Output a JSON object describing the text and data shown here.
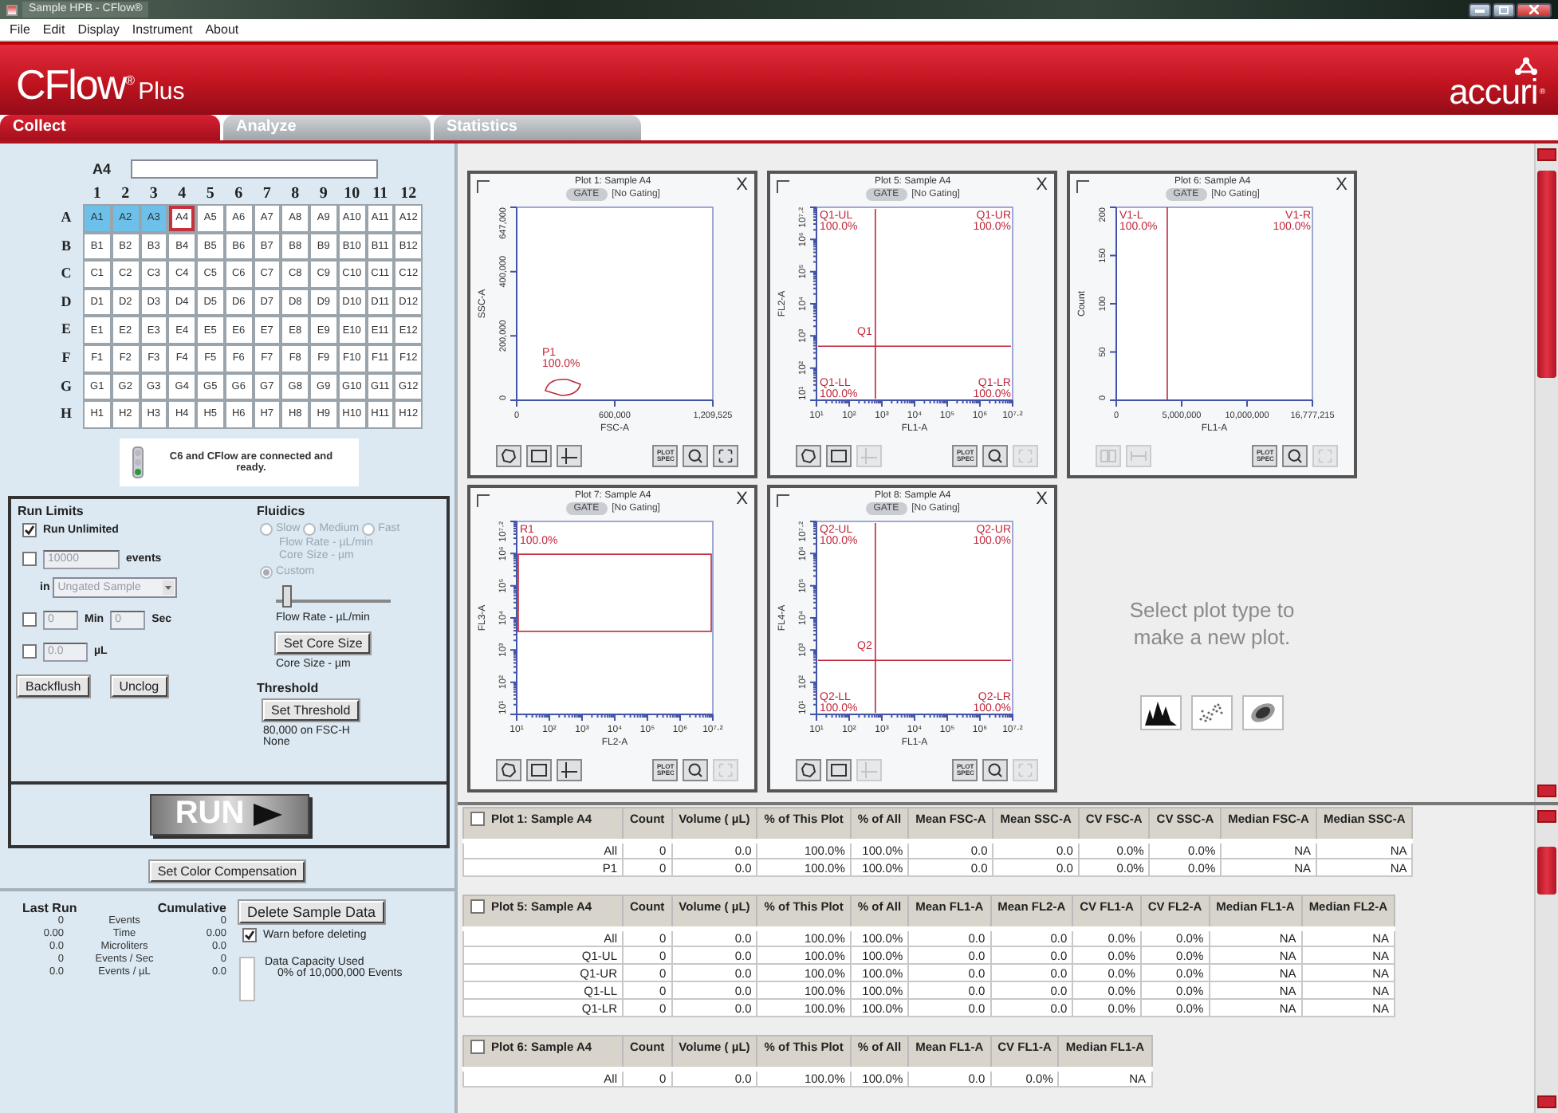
{
  "window": {
    "title": "Sample HPB - CFlow®"
  },
  "menu": [
    "File",
    "Edit",
    "Display",
    "Instrument",
    "About"
  ],
  "header": {
    "product": "CFlow",
    "product_mark": "®",
    "edition": "Plus",
    "brand": "accuri",
    "brand_mark": "®"
  },
  "tabs": [
    {
      "label": "Collect",
      "selected": true
    },
    {
      "label": "Analyze",
      "selected": false
    },
    {
      "label": "Statistics",
      "selected": false
    }
  ],
  "plate": {
    "current": "A4",
    "columns": [
      "1",
      "2",
      "3",
      "4",
      "5",
      "6",
      "7",
      "8",
      "9",
      "10",
      "11",
      "12"
    ],
    "rows": [
      {
        "label": "A",
        "wells": [
          {
            "label": "A1",
            "selected": true,
            "current": false
          },
          {
            "label": "A2",
            "selected": true,
            "current": false
          },
          {
            "label": "A3",
            "selected": true,
            "current": false
          },
          {
            "label": "A4",
            "selected": false,
            "current": true
          },
          {
            "label": "A5",
            "selected": false,
            "current": false
          },
          {
            "label": "A6",
            "selected": false,
            "current": false
          },
          {
            "label": "A7",
            "selected": false,
            "current": false
          },
          {
            "label": "A8",
            "selected": false,
            "current": false
          },
          {
            "label": "A9",
            "selected": false,
            "current": false
          },
          {
            "label": "A10",
            "selected": false,
            "current": false
          },
          {
            "label": "A11",
            "selected": false,
            "current": false
          },
          {
            "label": "A12",
            "selected": false,
            "current": false
          }
        ]
      },
      {
        "label": "B",
        "wells": [
          {
            "label": "B1",
            "selected": false,
            "current": false
          },
          {
            "label": "B2",
            "selected": false,
            "current": false
          },
          {
            "label": "B3",
            "selected": false,
            "current": false
          },
          {
            "label": "B4",
            "selected": false,
            "current": false
          },
          {
            "label": "B5",
            "selected": false,
            "current": false
          },
          {
            "label": "B6",
            "selected": false,
            "current": false
          },
          {
            "label": "B7",
            "selected": false,
            "current": false
          },
          {
            "label": "B8",
            "selected": false,
            "current": false
          },
          {
            "label": "B9",
            "selected": false,
            "current": false
          },
          {
            "label": "B10",
            "selected": false,
            "current": false
          },
          {
            "label": "B11",
            "selected": false,
            "current": false
          },
          {
            "label": "B12",
            "selected": false,
            "current": false
          }
        ]
      },
      {
        "label": "C",
        "wells": [
          {
            "label": "C1",
            "selected": false,
            "current": false
          },
          {
            "label": "C2",
            "selected": false,
            "current": false
          },
          {
            "label": "C3",
            "selected": false,
            "current": false
          },
          {
            "label": "C4",
            "selected": false,
            "current": false
          },
          {
            "label": "C5",
            "selected": false,
            "current": false
          },
          {
            "label": "C6",
            "selected": false,
            "current": false
          },
          {
            "label": "C7",
            "selected": false,
            "current": false
          },
          {
            "label": "C8",
            "selected": false,
            "current": false
          },
          {
            "label": "C9",
            "selected": false,
            "current": false
          },
          {
            "label": "C10",
            "selected": false,
            "current": false
          },
          {
            "label": "C11",
            "selected": false,
            "current": false
          },
          {
            "label": "C12",
            "selected": false,
            "current": false
          }
        ]
      },
      {
        "label": "D",
        "wells": [
          {
            "label": "D1",
            "selected": false,
            "current": false
          },
          {
            "label": "D2",
            "selected": false,
            "current": false
          },
          {
            "label": "D3",
            "selected": false,
            "current": false
          },
          {
            "label": "D4",
            "selected": false,
            "current": false
          },
          {
            "label": "D5",
            "selected": false,
            "current": false
          },
          {
            "label": "D6",
            "selected": false,
            "current": false
          },
          {
            "label": "D7",
            "selected": false,
            "current": false
          },
          {
            "label": "D8",
            "selected": false,
            "current": false
          },
          {
            "label": "D9",
            "selected": false,
            "current": false
          },
          {
            "label": "D10",
            "selected": false,
            "current": false
          },
          {
            "label": "D11",
            "selected": false,
            "current": false
          },
          {
            "label": "D12",
            "selected": false,
            "current": false
          }
        ]
      },
      {
        "label": "E",
        "wells": [
          {
            "label": "E1",
            "selected": false,
            "current": false
          },
          {
            "label": "E2",
            "selected": false,
            "current": false
          },
          {
            "label": "E3",
            "selected": false,
            "current": false
          },
          {
            "label": "E4",
            "selected": false,
            "current": false
          },
          {
            "label": "E5",
            "selected": false,
            "current": false
          },
          {
            "label": "E6",
            "selected": false,
            "current": false
          },
          {
            "label": "E7",
            "selected": false,
            "current": false
          },
          {
            "label": "E8",
            "selected": false,
            "current": false
          },
          {
            "label": "E9",
            "selected": false,
            "current": false
          },
          {
            "label": "E10",
            "selected": false,
            "current": false
          },
          {
            "label": "E11",
            "selected": false,
            "current": false
          },
          {
            "label": "E12",
            "selected": false,
            "current": false
          }
        ]
      },
      {
        "label": "F",
        "wells": [
          {
            "label": "F1",
            "selected": false,
            "current": false
          },
          {
            "label": "F2",
            "selected": false,
            "current": false
          },
          {
            "label": "F3",
            "selected": false,
            "current": false
          },
          {
            "label": "F4",
            "selected": false,
            "current": false
          },
          {
            "label": "F5",
            "selected": false,
            "current": false
          },
          {
            "label": "F6",
            "selected": false,
            "current": false
          },
          {
            "label": "F7",
            "selected": false,
            "current": false
          },
          {
            "label": "F8",
            "selected": false,
            "current": false
          },
          {
            "label": "F9",
            "selected": false,
            "current": false
          },
          {
            "label": "F10",
            "selected": false,
            "current": false
          },
          {
            "label": "F11",
            "selected": false,
            "current": false
          },
          {
            "label": "F12",
            "selected": false,
            "current": false
          }
        ]
      },
      {
        "label": "G",
        "wells": [
          {
            "label": "G1",
            "selected": false,
            "current": false
          },
          {
            "label": "G2",
            "selected": false,
            "current": false
          },
          {
            "label": "G3",
            "selected": false,
            "current": false
          },
          {
            "label": "G4",
            "selected": false,
            "current": false
          },
          {
            "label": "G5",
            "selected": false,
            "current": false
          },
          {
            "label": "G6",
            "selected": false,
            "current": false
          },
          {
            "label": "G7",
            "selected": false,
            "current": false
          },
          {
            "label": "G8",
            "selected": false,
            "current": false
          },
          {
            "label": "G9",
            "selected": false,
            "current": false
          },
          {
            "label": "G10",
            "selected": false,
            "current": false
          },
          {
            "label": "G11",
            "selected": false,
            "current": false
          },
          {
            "label": "G12",
            "selected": false,
            "current": false
          }
        ]
      },
      {
        "label": "H",
        "wells": [
          {
            "label": "H1",
            "selected": false,
            "current": false
          },
          {
            "label": "H2",
            "selected": false,
            "current": false
          },
          {
            "label": "H3",
            "selected": false,
            "current": false
          },
          {
            "label": "H4",
            "selected": false,
            "current": false
          },
          {
            "label": "H5",
            "selected": false,
            "current": false
          },
          {
            "label": "H6",
            "selected": false,
            "current": false
          },
          {
            "label": "H7",
            "selected": false,
            "current": false
          },
          {
            "label": "H8",
            "selected": false,
            "current": false
          },
          {
            "label": "H9",
            "selected": false,
            "current": false
          },
          {
            "label": "H10",
            "selected": false,
            "current": false
          },
          {
            "label": "H11",
            "selected": false,
            "current": false
          },
          {
            "label": "H12",
            "selected": false,
            "current": false
          }
        ]
      }
    ]
  },
  "status": "C6 and CFlow are connected and ready.",
  "run_limits": {
    "title": "Run Limits",
    "unlimited": {
      "label": "Run Unlimited",
      "checked": true
    },
    "events": {
      "checked": false,
      "value": "10000",
      "unit": "events"
    },
    "gate": {
      "prefix": "in",
      "value": "Ungated Sample"
    },
    "time": {
      "checked": false,
      "min": "0",
      "min_unit": "Min",
      "sec": "0",
      "sec_unit": "Sec"
    },
    "volume": {
      "checked": false,
      "value": "0.0",
      "unit": "µL"
    },
    "buttons": [
      "Backflush",
      "Unclog"
    ]
  },
  "fluidics": {
    "title": "Fluidics",
    "disabled": true,
    "speeds": [
      {
        "label": "Slow",
        "selected": false
      },
      {
        "label": "Medium",
        "selected": false
      },
      {
        "label": "Fast",
        "selected": false
      }
    ],
    "speed_info": [
      "Flow Rate - µL/min",
      "Core Size - µm"
    ],
    "custom": {
      "label": "Custom",
      "selected": true
    },
    "flow": {
      "level": 0.1,
      "label": "Flow Rate  - µL/min"
    },
    "core_button": "Set Core Size",
    "core_label": "Core Size - µm"
  },
  "threshold": {
    "title": "Threshold",
    "button": "Set Threshold",
    "lines": [
      "80,000 on FSC-H",
      "None"
    ]
  },
  "run_button": "RUN",
  "compensation_button": "Set Color Compensation",
  "counters": {
    "headers": [
      "Last Run",
      "Cumulative"
    ],
    "rows": [
      {
        "last": "0",
        "label": "Events",
        "total": "0"
      },
      {
        "last": "0.00",
        "label": "Time",
        "total": "0.00"
      },
      {
        "last": "0.0",
        "label": "Microliters",
        "total": "0.0"
      },
      {
        "last": "0",
        "label": "Events / Sec",
        "total": "0"
      },
      {
        "last": "0.0",
        "label": "Events / µL",
        "total": "0.0"
      }
    ]
  },
  "delete": {
    "button": "Delete Sample Data",
    "warn": {
      "label": "Warn before deleting",
      "checked": true
    },
    "capacity": {
      "title": "Data Capacity Used",
      "level": 0,
      "note": "0% of 10,000,000 Events"
    }
  },
  "plots": [
    {
      "title": "Plot 1: Sample A4",
      "checked": false,
      "gate_button": "GATE",
      "gating": "[No Gating]",
      "close": "X",
      "kind": "linear",
      "x_label": "FSC-A",
      "y_label": "SSC-A",
      "x_ticks": [
        "0",
        "600,000",
        "1,209,525"
      ],
      "y_ticks": [
        "0",
        "200,000",
        "400,000",
        "647,000"
      ],
      "gate": {
        "kind": "polygon",
        "regions": [
          {
            "name": "P1",
            "percent": "100.0%"
          }
        ]
      },
      "tools": [
        {
          "kind": "polygon",
          "disabled": false
        },
        {
          "kind": "rectangle",
          "disabled": false
        },
        {
          "kind": "quadrant",
          "disabled": false
        },
        {
          "kind": "spec",
          "label": "PLOT SPEC",
          "disabled": false
        },
        {
          "kind": "zoom",
          "disabled": false
        },
        {
          "kind": "fit",
          "disabled": false
        }
      ]
    },
    {
      "title": "Plot 5: Sample A4",
      "checked": false,
      "gate_button": "GATE",
      "gating": "[No Gating]",
      "close": "X",
      "kind": "log",
      "x_label": "FL1-A",
      "y_label": "FL2-A",
      "x_ticks": [
        "10¹",
        "10²",
        "10³",
        "10⁴",
        "10⁵",
        "10⁶",
        "10⁷·²"
      ],
      "y_ticks": [
        "10¹",
        "10²",
        "10³",
        "10⁴",
        "10⁵",
        "10⁶",
        "10⁷·²"
      ],
      "gate": {
        "kind": "quadrant",
        "label": "Q1",
        "regions": [
          {
            "name": "Q1-UL",
            "percent": "100.0%"
          },
          {
            "name": "Q1-UR",
            "percent": "100.0%"
          },
          {
            "name": "Q1-LL",
            "percent": "100.0%"
          },
          {
            "name": "Q1-LR",
            "percent": "100.0%"
          }
        ]
      },
      "tools": [
        {
          "kind": "polygon",
          "disabled": false
        },
        {
          "kind": "rectangle",
          "disabled": false
        },
        {
          "kind": "quadrant",
          "disabled": true
        },
        {
          "kind": "spec",
          "label": "PLOT SPEC",
          "disabled": false
        },
        {
          "kind": "zoom",
          "disabled": false
        },
        {
          "kind": "fit",
          "disabled": true
        }
      ]
    },
    {
      "title": "Plot 6: Sample A4",
      "checked": false,
      "gate_button": "GATE",
      "gating": "[No Gating]",
      "close": "X",
      "kind": "linear",
      "x_label": "FL1-A",
      "y_label": "Count",
      "x_ticks": [
        "0",
        "5,000,000",
        "10,000,000",
        "16,777,215"
      ],
      "y_ticks": [
        "0",
        "50",
        "100",
        "150",
        "200"
      ],
      "gate": {
        "kind": "marker",
        "regions": [
          {
            "name": "V1-L",
            "percent": "100.0%"
          },
          {
            "name": "V1-R",
            "percent": "100.0%"
          }
        ]
      },
      "tools": [
        {
          "kind": "split",
          "disabled": true
        },
        {
          "kind": "range",
          "disabled": true
        },
        {
          "kind": "spec",
          "label": "PLOT SPEC",
          "disabled": false
        },
        {
          "kind": "zoom",
          "disabled": false
        },
        {
          "kind": "fit",
          "disabled": true
        }
      ]
    },
    {
      "title": "Plot 7: Sample A4",
      "checked": false,
      "gate_button": "GATE",
      "gating": "[No Gating]",
      "close": "X",
      "kind": "log",
      "x_label": "FL2-A",
      "y_label": "FL3-A",
      "x_ticks": [
        "10¹",
        "10²",
        "10³",
        "10⁴",
        "10⁵",
        "10⁶",
        "10⁷·²"
      ],
      "y_ticks": [
        "10¹",
        "10²",
        "10³",
        "10⁴",
        "10⁵",
        "10⁶",
        "10⁷·²"
      ],
      "gate": {
        "kind": "band",
        "regions": [
          {
            "name": "R1",
            "percent": "100.0%"
          }
        ]
      },
      "tools": [
        {
          "kind": "polygon",
          "disabled": false
        },
        {
          "kind": "rectangle",
          "disabled": false
        },
        {
          "kind": "quadrant",
          "disabled": false
        },
        {
          "kind": "spec",
          "label": "PLOT SPEC",
          "disabled": false
        },
        {
          "kind": "zoom",
          "disabled": false
        },
        {
          "kind": "fit",
          "disabled": true
        }
      ]
    },
    {
      "title": "Plot 8: Sample A4",
      "checked": false,
      "gate_button": "GATE",
      "gating": "[No Gating]",
      "close": "X",
      "kind": "log",
      "x_label": "FL1-A",
      "y_label": "FL4-A",
      "x_ticks": [
        "10¹",
        "10²",
        "10³",
        "10⁴",
        "10⁵",
        "10⁶",
        "10⁷·²"
      ],
      "y_ticks": [
        "10¹",
        "10²",
        "10³",
        "10⁴",
        "10⁵",
        "10⁶",
        "10⁷·²"
      ],
      "gate": {
        "kind": "quadrant",
        "label": "Q2",
        "regions": [
          {
            "name": "Q2-UL",
            "percent": "100.0%"
          },
          {
            "name": "Q2-UR",
            "percent": "100.0%"
          },
          {
            "name": "Q2-LL",
            "percent": "100.0%"
          },
          {
            "name": "Q2-LR",
            "percent": "100.0%"
          }
        ]
      },
      "tools": [
        {
          "kind": "polygon",
          "disabled": false
        },
        {
          "kind": "rectangle",
          "disabled": false
        },
        {
          "kind": "quadrant",
          "disabled": true
        },
        {
          "kind": "spec",
          "label": "PLOT SPEC",
          "disabled": false
        },
        {
          "kind": "zoom",
          "disabled": false
        },
        {
          "kind": "fit",
          "disabled": true
        }
      ]
    }
  ],
  "new_plot": {
    "prompt": "Select plot type to make a new plot.",
    "types": [
      {
        "kind": "histogram"
      },
      {
        "kind": "dot"
      },
      {
        "kind": "density"
      }
    ]
  },
  "tables": [
    {
      "title": "Plot 1: Sample A4",
      "checked": false,
      "columns": [
        "Count",
        "Volume ( µL)",
        "% of This Plot",
        "% of All",
        "Mean FSC-A",
        "Mean SSC-A",
        "CV FSC-A",
        "CV SSC-A",
        "Median FSC-A",
        "Median SSC-A"
      ],
      "rows": [
        {
          "label": "All",
          "cells": [
            "0",
            "0.0",
            "100.0%",
            "100.0%",
            "0.0",
            "0.0",
            "0.0%",
            "0.0%",
            "NA",
            "NA"
          ]
        },
        {
          "label": "P1",
          "cells": [
            "0",
            "0.0",
            "100.0%",
            "100.0%",
            "0.0",
            "0.0",
            "0.0%",
            "0.0%",
            "NA",
            "NA"
          ]
        }
      ]
    },
    {
      "title": "Plot 5: Sample A4",
      "checked": false,
      "columns": [
        "Count",
        "Volume ( µL)",
        "% of This Plot",
        "% of All",
        "Mean FL1-A",
        "Mean FL2-A",
        "CV FL1-A",
        "CV FL2-A",
        "Median FL1-A",
        "Median FL2-A"
      ],
      "rows": [
        {
          "label": "All",
          "cells": [
            "0",
            "0.0",
            "100.0%",
            "100.0%",
            "0.0",
            "0.0",
            "0.0%",
            "0.0%",
            "NA",
            "NA"
          ]
        },
        {
          "label": "Q1-UL",
          "cells": [
            "0",
            "0.0",
            "100.0%",
            "100.0%",
            "0.0",
            "0.0",
            "0.0%",
            "0.0%",
            "NA",
            "NA"
          ]
        },
        {
          "label": "Q1-UR",
          "cells": [
            "0",
            "0.0",
            "100.0%",
            "100.0%",
            "0.0",
            "0.0",
            "0.0%",
            "0.0%",
            "NA",
            "NA"
          ]
        },
        {
          "label": "Q1-LL",
          "cells": [
            "0",
            "0.0",
            "100.0%",
            "100.0%",
            "0.0",
            "0.0",
            "0.0%",
            "0.0%",
            "NA",
            "NA"
          ]
        },
        {
          "label": "Q1-LR",
          "cells": [
            "0",
            "0.0",
            "100.0%",
            "100.0%",
            "0.0",
            "0.0",
            "0.0%",
            "0.0%",
            "NA",
            "NA"
          ]
        }
      ]
    },
    {
      "title": "Plot 6: Sample A4",
      "checked": false,
      "columns": [
        "Count",
        "Volume ( µL)",
        "% of This Plot",
        "% of All",
        "Mean FL1-A",
        "CV FL1-A",
        "Median FL1-A"
      ],
      "rows": [
        {
          "label": "All",
          "cells": [
            "0",
            "0.0",
            "100.0%",
            "100.0%",
            "0.0",
            "0.0%",
            "NA"
          ]
        }
      ]
    }
  ]
}
